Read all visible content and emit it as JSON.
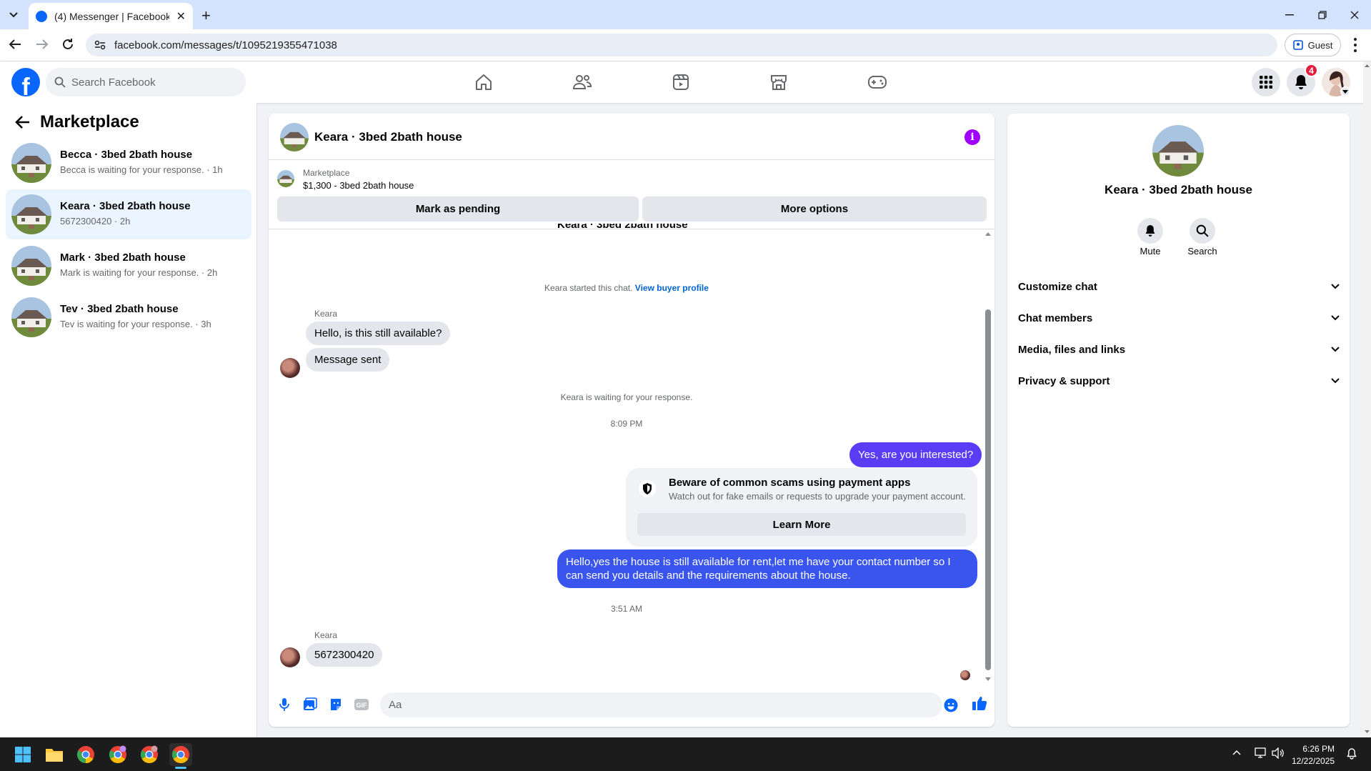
{
  "browser": {
    "tab_title": "(4) Messenger | Facebook",
    "url": "facebook.com/messages/t/1095219355471038",
    "guest_label": "Guest"
  },
  "fb": {
    "search_placeholder": "Search Facebook",
    "notifications_count": "4"
  },
  "left": {
    "title": "Marketplace",
    "conversations": [
      {
        "name": "Becca · 3bed 2bath house",
        "sub": "Becca is waiting for your response. · 1h"
      },
      {
        "name": "Keara · 3bed 2bath house",
        "sub": "5672300420 · 2h"
      },
      {
        "name": "Mark · 3bed 2bath house",
        "sub": "Mark is waiting for your response. · 2h"
      },
      {
        "name": "Tev · 3bed 2bath house",
        "sub": "Tev is waiting for your response. · 3h"
      }
    ]
  },
  "chat": {
    "header_name": "Keara · 3bed 2bath house",
    "marketplace_label": "Marketplace",
    "listing": "$1,300 - 3bed 2bath house",
    "mark_pending": "Mark as pending",
    "more_options": "More options",
    "cut_title": "Keara · 3bed 2bath house",
    "started_text": "Keara started this chat.",
    "view_buyer": "View buyer profile",
    "sender1": "Keara",
    "msg1": "Hello, is this still available?",
    "msg2": "Message sent",
    "waiting": "Keara is waiting for your response.",
    "time1": "8:09 PM",
    "out1": "Yes, are you interested?",
    "scam_title": "Beware of common scams using payment apps",
    "scam_sub": "Watch out for fake emails or requests to upgrade your payment account.",
    "learn_more": "Learn More",
    "out2_line1": "Hello,yes the house is still available for rent,let me have your contact number   so I",
    "out2_line2": "can send you details and the requirements about the house.",
    "time2": "3:51 AM",
    "sender2": "Keara",
    "msg3": "5672300420",
    "composer_placeholder": "Aa"
  },
  "right": {
    "name": "Keara · 3bed 2bath house",
    "mute": "Mute",
    "search": "Search",
    "rows": [
      "Customize chat",
      "Chat members",
      "Media, files and links",
      "Privacy & support"
    ]
  },
  "taskbar": {
    "time": "6:26 PM",
    "date": "12/22/2025"
  },
  "colors": {
    "fb_blue": "#0866ff",
    "messenger_purple": "#7a3cf5",
    "active_conv": "#ebf5ff"
  }
}
